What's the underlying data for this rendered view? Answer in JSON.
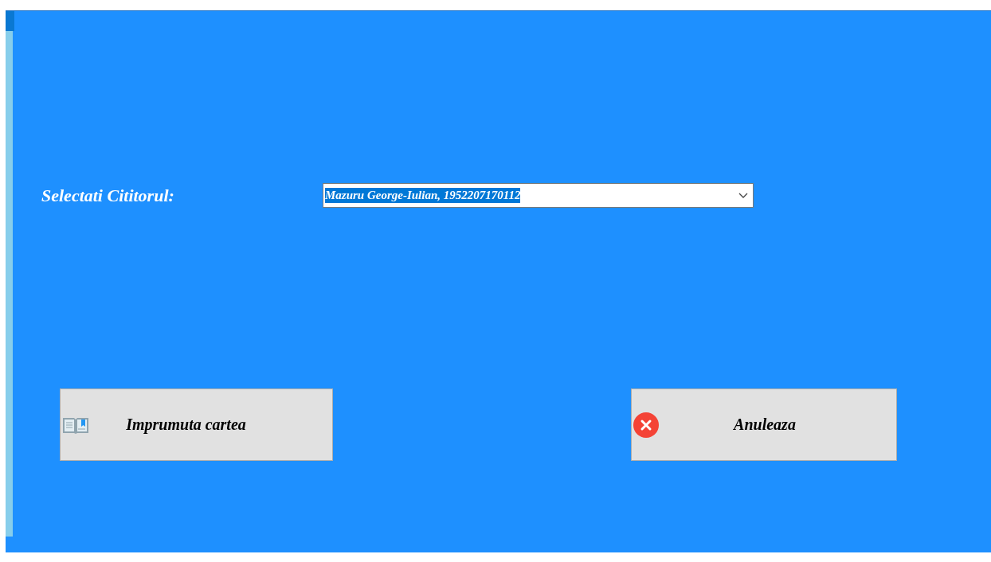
{
  "form": {
    "label": "Selectati Cititorul:",
    "reader_select": {
      "value": "Mazuru George-Iulian, 1952207170112",
      "text_selected": true
    }
  },
  "buttons": [
    {
      "kind": "borrow",
      "label": "Imprumuta cartea"
    },
    {
      "kind": "cancel",
      "label": "Anuleaza"
    }
  ]
}
